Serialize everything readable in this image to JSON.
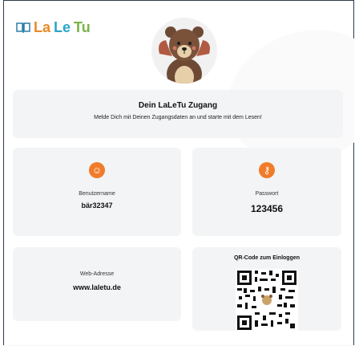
{
  "logo": {
    "part1": "La",
    "part2": "Le",
    "part3": "Tu"
  },
  "welcome": {
    "title": "Dein LaLeTu Zugang",
    "subtitle": "Melde Dich mit Deinen Zugangsdaten an und starte mit dem Lesen!"
  },
  "fields": {
    "username": {
      "label": "Benutzername",
      "value": "bär32347"
    },
    "password": {
      "label": "Passwort",
      "value": "123456"
    },
    "web": {
      "label": "Web-Adresse",
      "value": "www.laletu.de"
    },
    "qr": {
      "title": "QR-Code zum Einloggen"
    }
  },
  "colors": {
    "accent": "#f07c2b"
  }
}
